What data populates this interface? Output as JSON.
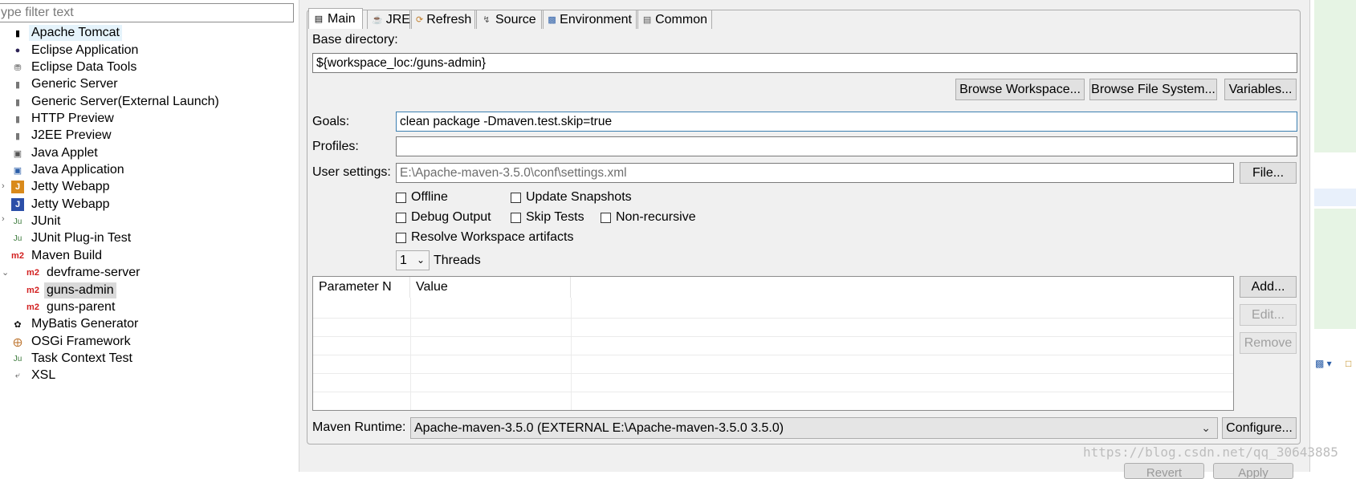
{
  "filter": {
    "placeholder": "ype filter text"
  },
  "tree": [
    {
      "label": "Apache Tomcat",
      "icon": "tomcat-icon"
    },
    {
      "label": "Eclipse Application",
      "icon": "eclipse-icon"
    },
    {
      "label": "Eclipse Data Tools",
      "icon": "database-icon"
    },
    {
      "label": "Generic Server",
      "icon": "server-icon"
    },
    {
      "label": "Generic Server(External Launch)",
      "icon": "server-icon"
    },
    {
      "label": "HTTP Preview",
      "icon": "server-icon"
    },
    {
      "label": "J2EE Preview",
      "icon": "server-icon"
    },
    {
      "label": "Java Applet",
      "icon": "applet-icon"
    },
    {
      "label": "Java Application",
      "icon": "java-app-icon"
    },
    {
      "label": "Jetty Webapp",
      "icon": "jetty-icon"
    },
    {
      "label": "Jetty Webapp",
      "icon": "jetty-icon"
    },
    {
      "label": "JUnit",
      "icon": "junit-icon"
    },
    {
      "label": "JUnit Plug-in Test",
      "icon": "junit-plugin-icon"
    },
    {
      "label": "Maven Build",
      "icon": "m2-icon"
    },
    {
      "label": "devframe-server",
      "icon": "m2-icon"
    },
    {
      "label": "guns-admin",
      "icon": "m2-icon"
    },
    {
      "label": "guns-parent",
      "icon": "m2-icon"
    },
    {
      "label": "MyBatis Generator",
      "icon": "mybatis-icon"
    },
    {
      "label": "OSGi Framework",
      "icon": "osgi-icon"
    },
    {
      "label": "Task Context Test",
      "icon": "junit-icon"
    },
    {
      "label": "XSL",
      "icon": "xsl-icon"
    }
  ],
  "tabs": [
    {
      "label": "Main"
    },
    {
      "label": "JRE"
    },
    {
      "label": "Refresh"
    },
    {
      "label": "Source"
    },
    {
      "label": "Environment"
    },
    {
      "label": "Common"
    }
  ],
  "main": {
    "base_dir_label": "Base directory:",
    "base_dir_value": "${workspace_loc:/guns-admin}",
    "browse_workspace": "Browse Workspace...",
    "browse_fs": "Browse File System...",
    "variables": "Variables...",
    "goals_label": "Goals:",
    "goals_value": "clean package -Dmaven.test.skip=true",
    "profiles_label": "Profiles:",
    "profiles_value": "",
    "user_settings_label": "User settings:",
    "user_settings_value": "E:\\Apache-maven-3.5.0\\conf\\settings.xml",
    "file_button": "File...",
    "offline": "Offline",
    "update_snapshots": "Update Snapshots",
    "debug_output": "Debug Output",
    "skip_tests": "Skip Tests",
    "non_recursive": "Non-recursive",
    "resolve_workspace": "Resolve Workspace artifacts",
    "threads_value": "1",
    "threads_label": "Threads",
    "param_col1": "Parameter N",
    "param_col2": "Value",
    "add": "Add...",
    "edit": "Edit...",
    "remove": "Remove",
    "runtime_label": "Maven Runtime:",
    "runtime_value": "Apache-maven-3.5.0 (EXTERNAL E:\\Apache-maven-3.5.0 3.5.0)",
    "configure": "Configure..."
  },
  "footer": {
    "revert": "Revert",
    "apply": "Apply"
  },
  "watermark": "https://blog.csdn.net/qq_30643885"
}
